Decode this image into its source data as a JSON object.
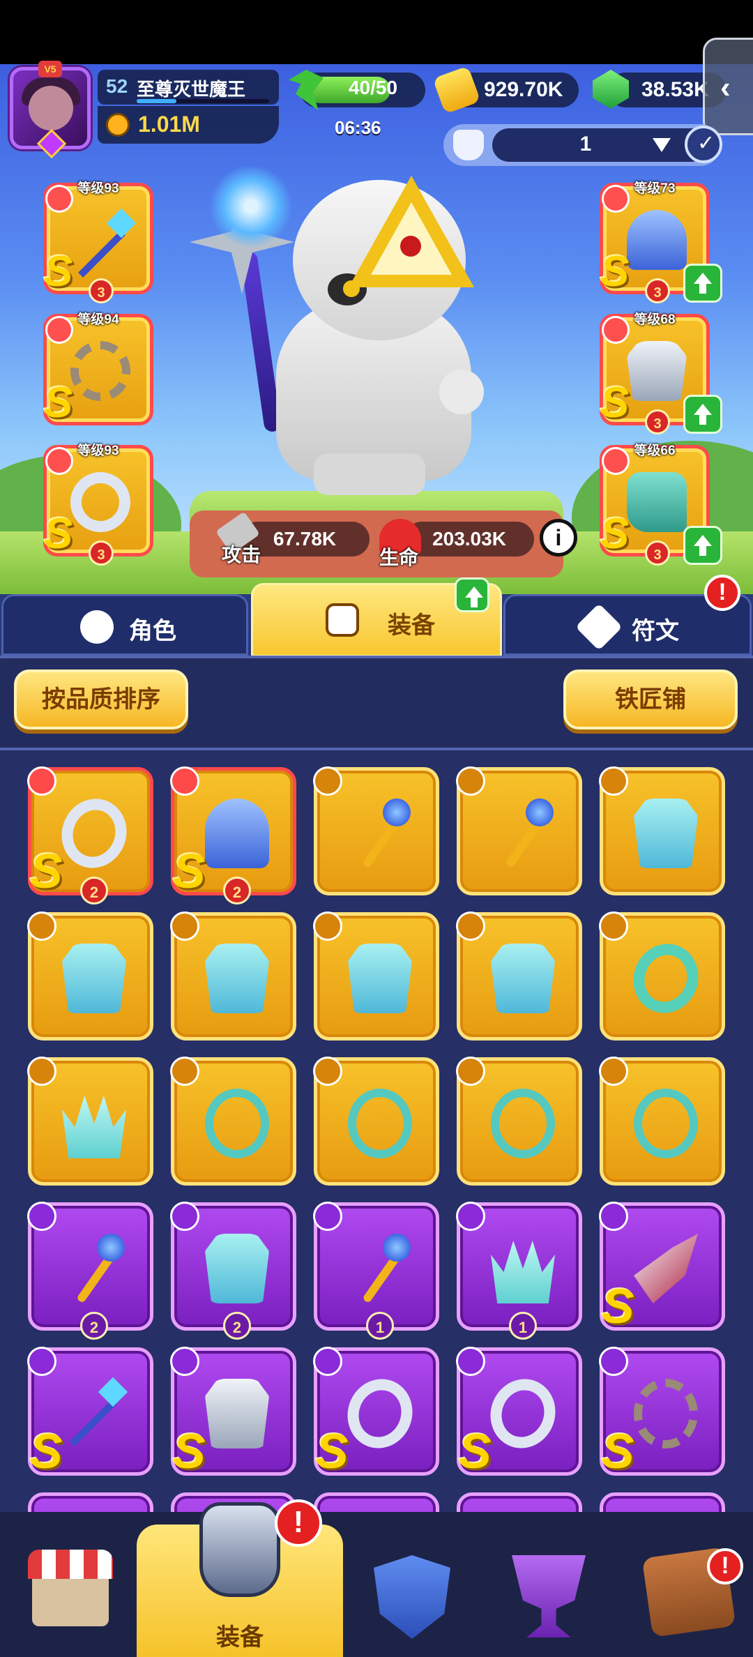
{
  "header": {
    "player_level": "52",
    "player_name": "至尊灭世魔王",
    "avatar_badge": "V5",
    "power": "1.01M",
    "energy": "40/50",
    "energy_fraction": 0.8,
    "timer": "06:36",
    "gold": "929.70K",
    "gems": "38.53K",
    "side_tab_icon": "chevron-left-icon",
    "preset_number": "1"
  },
  "equipped": {
    "left": [
      {
        "level": "等级93",
        "stars": "3",
        "item": "spear",
        "grade": "S"
      },
      {
        "level": "等级94",
        "stars": "",
        "item": "necklace",
        "grade": "S"
      },
      {
        "level": "等级93",
        "stars": "3",
        "item": "ring",
        "grade": "S"
      }
    ],
    "right": [
      {
        "level": "等级73",
        "stars": "3",
        "item": "helmet",
        "grade": "S",
        "upgrade": true
      },
      {
        "level": "等级68",
        "stars": "3",
        "item": "armor",
        "grade": "S",
        "upgrade": true
      },
      {
        "level": "等级66",
        "stars": "3",
        "item": "boots",
        "grade": "S",
        "upgrade": true
      }
    ]
  },
  "stats": {
    "attack_label": "攻击",
    "attack_value": "67.78K",
    "hp_label": "生命",
    "hp_value": "203.03K",
    "info_icon": "i"
  },
  "tabs": {
    "character": "角色",
    "equipment": "装备",
    "runes": "符文",
    "alert": "!"
  },
  "actions": {
    "sort_by_quality": "按品质排序",
    "blacksmith": "铁匠铺"
  },
  "inventory": [
    {
      "rarity": "gold",
      "s": true,
      "item": "ring",
      "stars": "2"
    },
    {
      "rarity": "gold",
      "s": true,
      "item": "helmet",
      "stars": "2"
    },
    {
      "rarity": "gold",
      "s": false,
      "item": "staff",
      "stars": ""
    },
    {
      "rarity": "gold",
      "s": false,
      "item": "staff",
      "stars": ""
    },
    {
      "rarity": "gold",
      "s": false,
      "item": "armor",
      "stars": ""
    },
    {
      "rarity": "gold",
      "s": false,
      "item": "armor",
      "stars": ""
    },
    {
      "rarity": "gold",
      "s": false,
      "item": "armor",
      "stars": ""
    },
    {
      "rarity": "gold",
      "s": false,
      "item": "armor",
      "stars": ""
    },
    {
      "rarity": "gold",
      "s": false,
      "item": "armor",
      "stars": ""
    },
    {
      "rarity": "gold",
      "s": false,
      "item": "ring-teal",
      "stars": ""
    },
    {
      "rarity": "gold",
      "s": false,
      "item": "crown",
      "stars": ""
    },
    {
      "rarity": "gold",
      "s": false,
      "item": "necklace",
      "stars": ""
    },
    {
      "rarity": "gold",
      "s": false,
      "item": "necklace",
      "stars": ""
    },
    {
      "rarity": "gold",
      "s": false,
      "item": "necklace",
      "stars": ""
    },
    {
      "rarity": "gold",
      "s": false,
      "item": "necklace",
      "stars": ""
    },
    {
      "rarity": "purple",
      "s": false,
      "item": "staff",
      "stars": "2"
    },
    {
      "rarity": "purple",
      "s": false,
      "item": "armor",
      "stars": "2"
    },
    {
      "rarity": "purple",
      "s": false,
      "item": "staff",
      "stars": "1"
    },
    {
      "rarity": "purple",
      "s": false,
      "item": "crown",
      "stars": "1"
    },
    {
      "rarity": "purple",
      "s": true,
      "item": "plane",
      "stars": ""
    },
    {
      "rarity": "purple",
      "s": true,
      "item": "spear",
      "stars": ""
    },
    {
      "rarity": "purple",
      "s": true,
      "item": "armor-silver",
      "stars": ""
    },
    {
      "rarity": "purple",
      "s": true,
      "item": "ring",
      "stars": ""
    },
    {
      "rarity": "purple",
      "s": true,
      "item": "ring",
      "stars": ""
    },
    {
      "rarity": "purple",
      "s": true,
      "item": "necklace-chain",
      "stars": ""
    }
  ],
  "grade_letter": "S",
  "bottom_nav": {
    "shop": "shop-icon",
    "equipment": "装备",
    "equipment_alert": "!",
    "heroes": "shield-icon",
    "trophy": "trophy-icon",
    "battle": "battle-icon",
    "battle_alert": "!"
  },
  "colors": {
    "gold_card": "#f7c22a",
    "purple_card": "#9b34e0",
    "accent_green": "#3fc43a",
    "alert_red": "#e52020"
  }
}
